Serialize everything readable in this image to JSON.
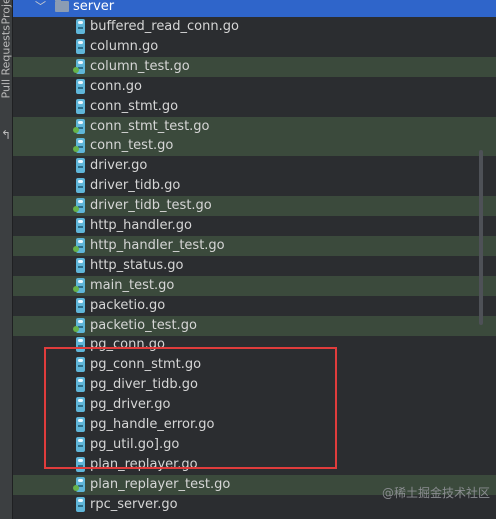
{
  "sidebar": {
    "project_label": "Proje",
    "pull_requests_label": "Pull Requests"
  },
  "tree": {
    "folder": "server",
    "files": [
      {
        "name": "buffered_read_conn.go",
        "test": false
      },
      {
        "name": "column.go",
        "test": false
      },
      {
        "name": "column_test.go",
        "test": true
      },
      {
        "name": "conn.go",
        "test": false
      },
      {
        "name": "conn_stmt.go",
        "test": false
      },
      {
        "name": "conn_stmt_test.go",
        "test": true
      },
      {
        "name": "conn_test.go",
        "test": true
      },
      {
        "name": "driver.go",
        "test": false
      },
      {
        "name": "driver_tidb.go",
        "test": false
      },
      {
        "name": "driver_tidb_test.go",
        "test": true
      },
      {
        "name": "http_handler.go",
        "test": false
      },
      {
        "name": "http_handler_test.go",
        "test": true
      },
      {
        "name": "http_status.go",
        "test": false
      },
      {
        "name": "main_test.go",
        "test": true
      },
      {
        "name": "packetio.go",
        "test": false
      },
      {
        "name": "packetio_test.go",
        "test": true
      },
      {
        "name": "pg_conn.go",
        "test": false
      },
      {
        "name": "pg_conn_stmt.go",
        "test": false
      },
      {
        "name": "pg_diver_tidb.go",
        "test": false
      },
      {
        "name": "pg_driver.go",
        "test": false
      },
      {
        "name": "pg_handle_error.go",
        "test": false
      },
      {
        "name": "pg_util.go].go",
        "test": false
      },
      {
        "name": "plan_replayer.go",
        "test": false
      },
      {
        "name": "plan_replayer_test.go",
        "test": true
      },
      {
        "name": "rpc_server.go",
        "test": false
      }
    ]
  },
  "watermark": "@稀土掘金技术社区",
  "colors": {
    "selection": "#2f65ca",
    "test_row": "#3b4a3c",
    "highlight_box": "#e03c3c"
  }
}
